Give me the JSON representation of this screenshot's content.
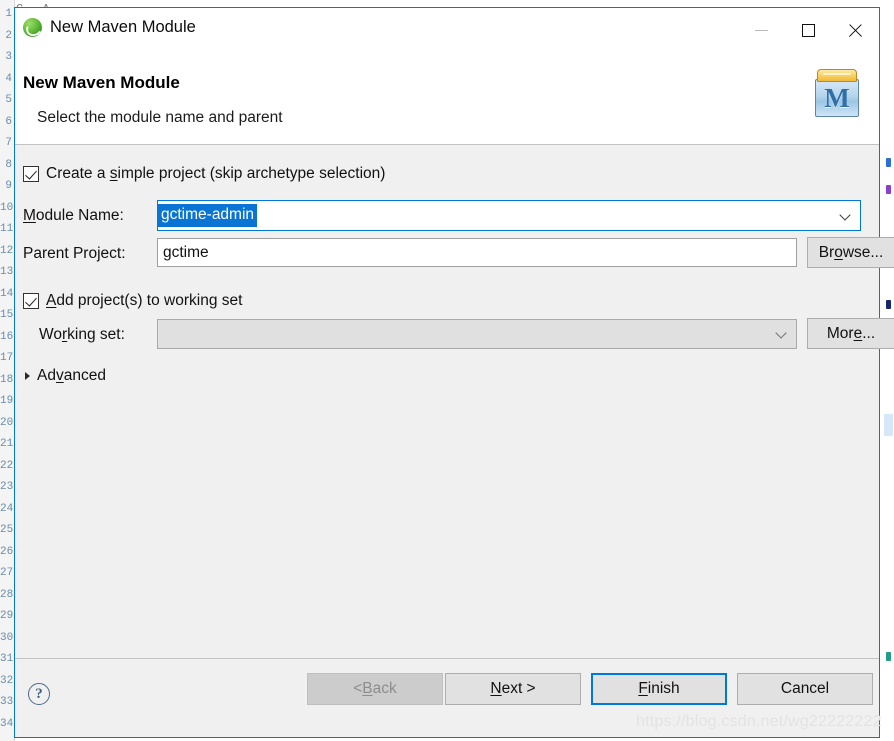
{
  "window": {
    "title": "New Maven Module",
    "app_icon": "maven-ball-icon",
    "controls": {
      "minimize": "minimize-icon",
      "maximize": "maximize-icon",
      "close": "close-icon"
    }
  },
  "header": {
    "title": "New Maven Module",
    "subtitle": "Select the module name and parent",
    "icon": "maven-crate-icon",
    "icon_letter": "M"
  },
  "form": {
    "simple_project": {
      "label_before": "Create a ",
      "label_mnemonic": "s",
      "label_after": "imple project (skip archetype selection)",
      "checked": true
    },
    "module_name": {
      "label_mnemonic": "M",
      "label_before": "",
      "label_after": "odule Name:",
      "value": "gctime-admin",
      "selected": true,
      "dropdown_icon": "chevron-down-icon"
    },
    "parent_project": {
      "label": "Parent Project:",
      "value": "gctime",
      "browse_button": {
        "before": "Br",
        "mnemonic": "o",
        "after": "wse..."
      }
    },
    "working_set_checkbox": {
      "label_mnemonic": "A",
      "label_after": "dd project(s) to working set",
      "checked": true
    },
    "working_set": {
      "label_before": "Wo",
      "label_mnemonic": "r",
      "label_after": "king set:",
      "value": "",
      "disabled": true,
      "dropdown_icon": "chevron-down-icon",
      "more_button": {
        "before": "Mor",
        "mnemonic": "e",
        "after": "..."
      }
    },
    "advanced": {
      "before": "Ad",
      "mnemonic": "v",
      "after": "anced",
      "expanded": false,
      "icon": "triangle-right-icon"
    }
  },
  "footer": {
    "help_icon": "question-mark-icon",
    "back": {
      "before": "< ",
      "mnemonic": "B",
      "after": "ack",
      "enabled": false
    },
    "next": {
      "before": "",
      "mnemonic": "N",
      "after": "ext >",
      "enabled": true
    },
    "finish": {
      "before": "",
      "mnemonic": "F",
      "after": "inish",
      "enabled": true,
      "default": true
    },
    "cancel": {
      "label": "Cancel",
      "enabled": true
    }
  },
  "watermark": "https://blog.csdn.net/wg22222222",
  "background": {
    "line_numbers": [
      "1",
      "2",
      "3",
      "4",
      "5",
      "6",
      "7",
      "8",
      "9",
      "10",
      "11",
      "12",
      "13",
      "14",
      "15",
      "16",
      "17",
      "18",
      "19",
      "20",
      "21",
      "22",
      "23",
      "24",
      "25",
      "26",
      "27",
      "28",
      "29",
      "30",
      "31",
      "32",
      "33",
      "34"
    ],
    "top_fragment": "C     A"
  },
  "colors": {
    "accent": "#0078d7",
    "selection": "#0a74d4",
    "dialog_bg": "#f0f0f0",
    "header_bg": "#ffffff",
    "disabled_text": "#8d8d8d"
  }
}
